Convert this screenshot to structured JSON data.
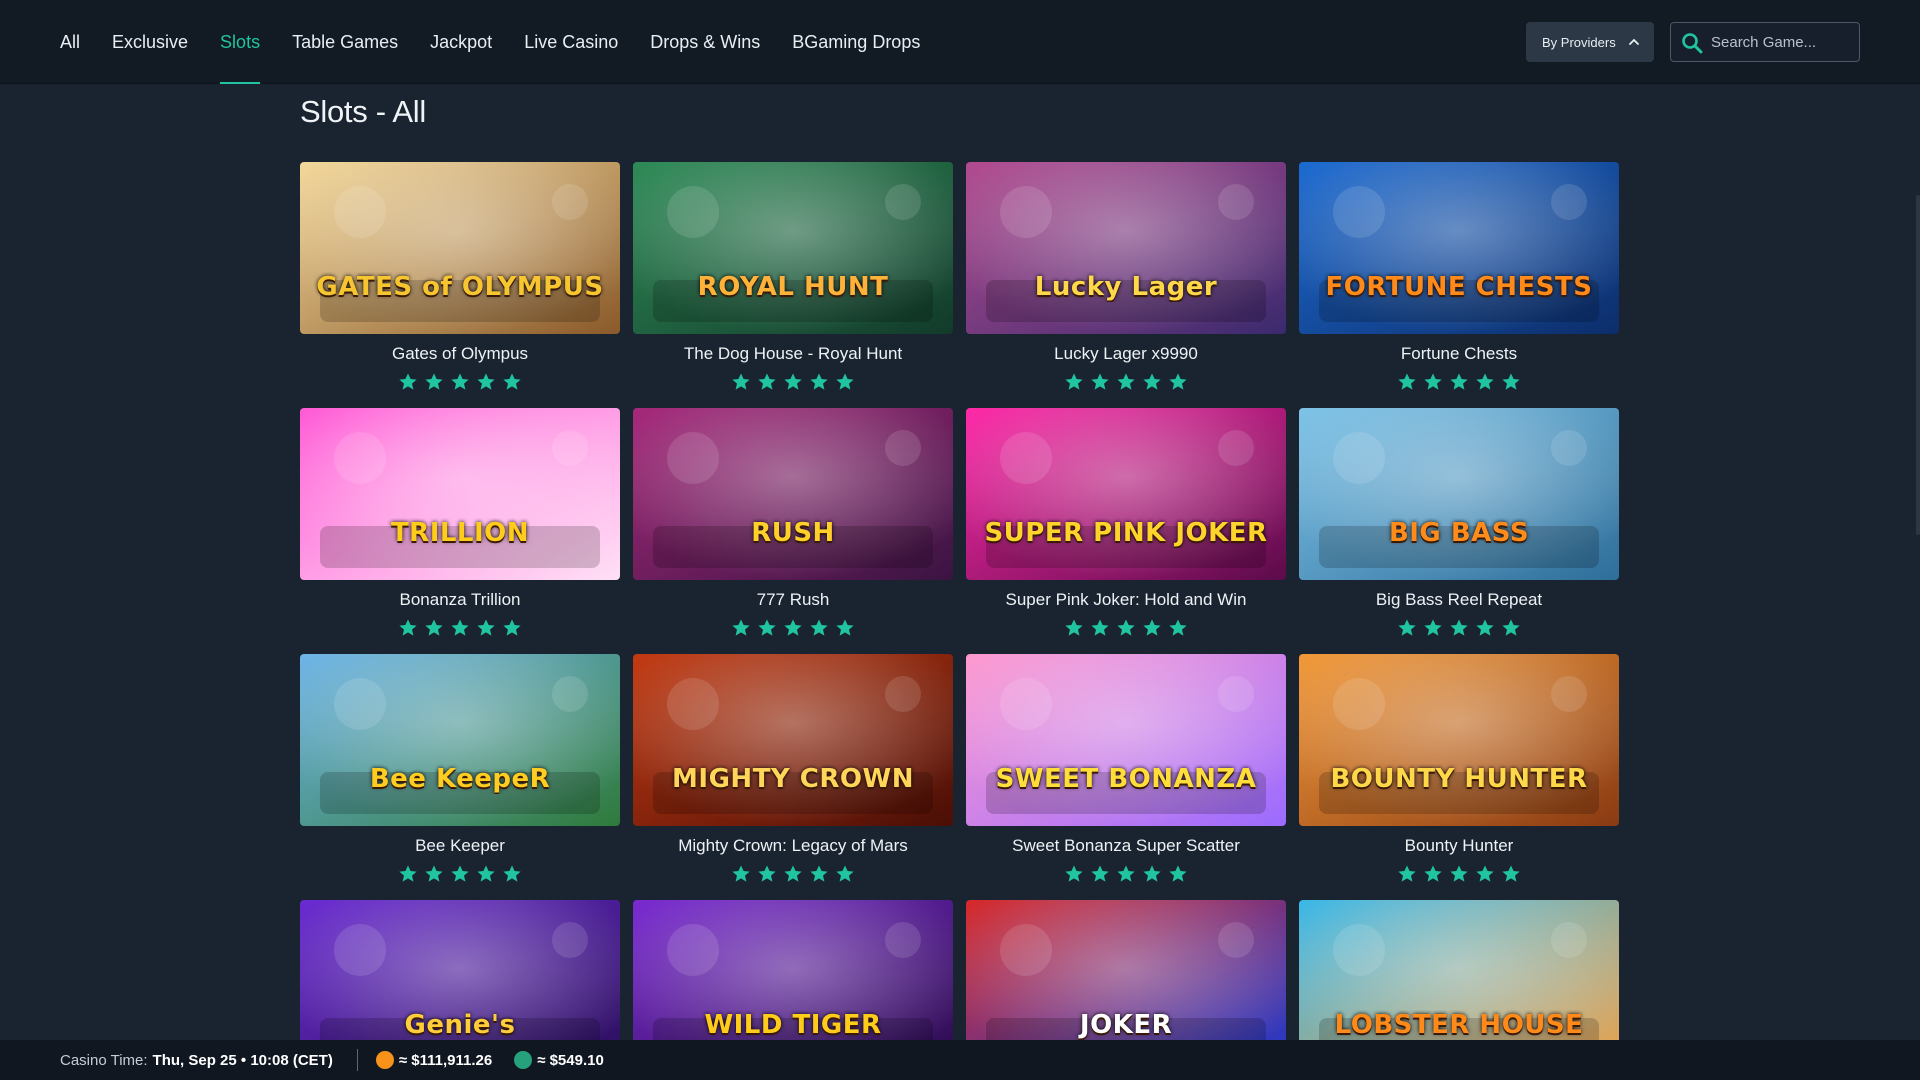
{
  "nav": {
    "tabs": [
      {
        "label": "All",
        "active": false
      },
      {
        "label": "Exclusive",
        "active": false
      },
      {
        "label": "Slots",
        "active": true
      },
      {
        "label": "Table Games",
        "active": false
      },
      {
        "label": "Jackpot",
        "active": false
      },
      {
        "label": "Live Casino",
        "active": false
      },
      {
        "label": "Drops & Wins",
        "active": false
      },
      {
        "label": "BGaming Drops",
        "active": false
      }
    ],
    "providers_label": "By Providers",
    "search_placeholder": "Search Game..."
  },
  "page": {
    "title": "Slots - All"
  },
  "colors": {
    "accent": "#21c4a0",
    "background": "#1a2431",
    "topbar": "#121a24"
  },
  "games": [
    {
      "name": "Gates of Olympus",
      "rating": 5,
      "art_text": "GATES of OLYMPUS",
      "c1": "#f3d89b",
      "c2": "#8a5a2a",
      "tc": "#f7c530"
    },
    {
      "name": "The Dog House - Royal Hunt",
      "rating": 5,
      "art_text": "ROYAL HUNT",
      "c1": "#2e8b57",
      "c2": "#123a2a",
      "tc": "#ffb23a"
    },
    {
      "name": "Lucky Lager x9990",
      "rating": 5,
      "art_text": "Lucky Lager",
      "c1": "#b24b8f",
      "c2": "#3b2a6e",
      "tc": "#ffd84a"
    },
    {
      "name": "Fortune Chests",
      "rating": 5,
      "art_text": "FORTUNE CHESTS",
      "c1": "#1d6bd1",
      "c2": "#0c2d6a",
      "tc": "#ff8a1a"
    },
    {
      "name": "Bonanza Trillion",
      "rating": 5,
      "art_text": "TRILLION",
      "c1": "#ff5ad5",
      "c2": "#ffe1f6",
      "tc": "#ffcc1a"
    },
    {
      "name": "777 Rush",
      "rating": 5,
      "art_text": "RUSH",
      "c1": "#a6287a",
      "c2": "#3a1442",
      "tc": "#ffcf2a"
    },
    {
      "name": "Super Pink Joker: Hold and Win",
      "rating": 5,
      "art_text": "SUPER PINK JOKER",
      "c1": "#ff2aa8",
      "c2": "#5b0b4a",
      "tc": "#ffd42a"
    },
    {
      "name": "Big Bass Reel Repeat",
      "rating": 5,
      "art_text": "BIG BASS",
      "c1": "#7fc4e8",
      "c2": "#2e6e9a",
      "tc": "#ff8c1a"
    },
    {
      "name": "Bee Keeper",
      "rating": 5,
      "art_text": "Bee KeepeR",
      "c1": "#6fb5e8",
      "c2": "#2f7a3a",
      "tc": "#ffcc22"
    },
    {
      "name": "Mighty Crown: Legacy of Mars",
      "rating": 5,
      "art_text": "MIGHTY CROWN",
      "c1": "#c23a12",
      "c2": "#4a0e06",
      "tc": "#ffd55a"
    },
    {
      "name": "Sweet Bonanza Super Scatter",
      "rating": 5,
      "art_text": "SWEET BONANZA",
      "c1": "#ff9ad0",
      "c2": "#9b6bff",
      "tc": "#ffde3a"
    },
    {
      "name": "Bounty Hunter",
      "rating": 5,
      "art_text": "BOUNTY HUNTER",
      "c1": "#f29a3a",
      "c2": "#8a3a12",
      "tc": "#ffd84a"
    },
    {
      "name": "",
      "rating": 0,
      "art_text": "Genie's",
      "c1": "#6a2bd1",
      "c2": "#2a0f5a",
      "tc": "#ffcc3a"
    },
    {
      "name": "",
      "rating": 0,
      "art_text": "WILD TIGER",
      "c1": "#7a2bd1",
      "c2": "#2a0b4a",
      "tc": "#ffcc1a"
    },
    {
      "name": "",
      "rating": 0,
      "art_text": "JOKER",
      "c1": "#d82a2a",
      "c2": "#1a3ad1",
      "tc": "#ffffff"
    },
    {
      "name": "",
      "rating": 0,
      "art_text": "LOBSTER HOUSE",
      "c1": "#3ab8e8",
      "c2": "#f0a24a",
      "tc": "#ff8a1a"
    }
  ],
  "footer": {
    "casino_time_label": "Casino Time:",
    "casino_time_value": "Thu, Sep 25 • 10:08 (CET)",
    "btc_rate": "≈ $111,911.26",
    "usdt_rate": "≈ $549.10"
  }
}
